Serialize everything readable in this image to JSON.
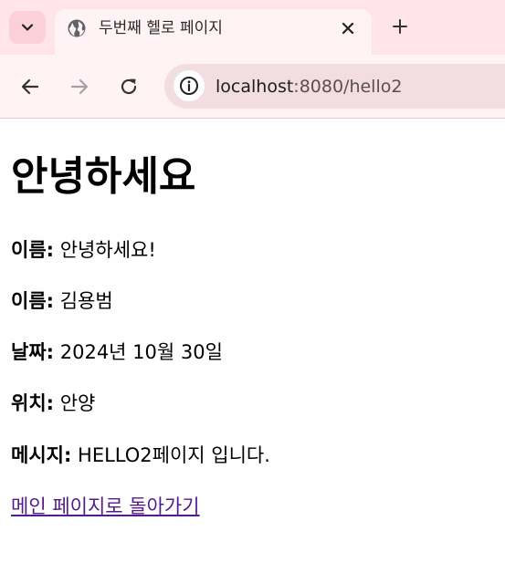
{
  "browser": {
    "tab": {
      "title": "두번째 헬로 페이지"
    },
    "address_bar": {
      "host": "localhost",
      "path": ":8080/hello2"
    },
    "icons": {
      "tab_search": "chevron-down-icon",
      "favicon": "globe-icon",
      "close": "close-icon",
      "new_tab": "plus-icon",
      "back": "arrow-left-icon",
      "forward": "arrow-right-icon",
      "reload": "reload-icon",
      "site_info": "info-icon"
    }
  },
  "page": {
    "heading": "안녕하세요",
    "rows": [
      {
        "label": "이름:",
        "value": "안녕하세요!"
      },
      {
        "label": "이름:",
        "value": "김용범"
      },
      {
        "label": "날짜:",
        "value": "2024년 10월 30일"
      },
      {
        "label": "위치:",
        "value": "안양"
      },
      {
        "label": "메시지:",
        "value": "HELLO2페이지 입니다."
      }
    ],
    "link_text": "메인 페이지로 돌아가기"
  }
}
